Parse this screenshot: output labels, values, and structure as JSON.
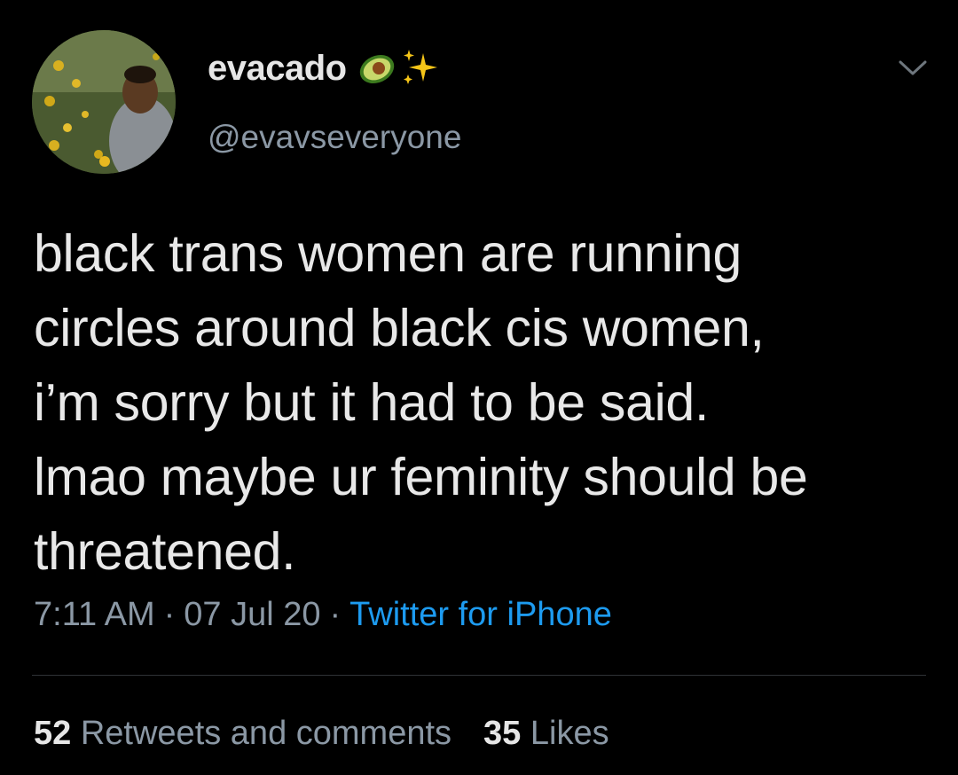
{
  "author": {
    "display_name": "evacado",
    "name_emojis": [
      "avocado-icon",
      "sparkles-icon"
    ],
    "handle": "@evavseveryone"
  },
  "tweet": {
    "lines": [
      "black trans women are running",
      "circles around black cis women,",
      "i’m sorry but it had to be said.",
      "lmao maybe ur feminity should be",
      "threatened."
    ],
    "time": "7:11 AM",
    "date": "07 Jul 20",
    "separator": "·",
    "source": "Twitter for iPhone"
  },
  "stats": {
    "retweets_count": "52",
    "retweets_label": "Retweets and comments",
    "likes_count": "35",
    "likes_label": "Likes"
  },
  "colors": {
    "background": "#000000",
    "text": "#e8e8e8",
    "muted": "#8b98a5",
    "link": "#1d9bf0",
    "divider": "#2f3336"
  }
}
